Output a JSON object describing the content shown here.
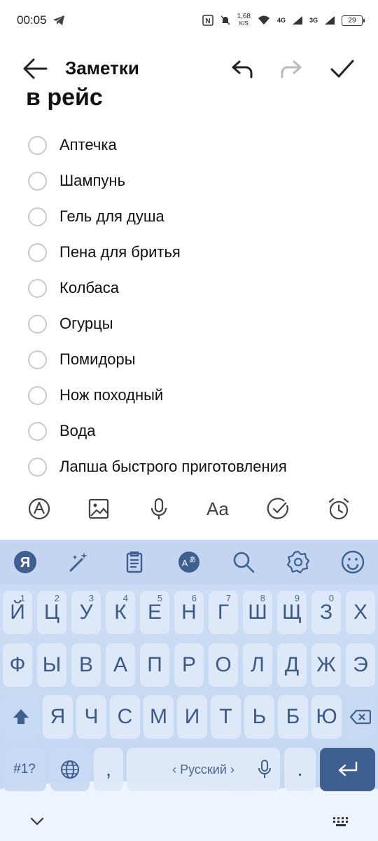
{
  "status": {
    "time": "00:05",
    "speed_value": "1,68",
    "speed_unit": "K/S",
    "net1": "4G",
    "net2": "3G",
    "battery": "29"
  },
  "header": {
    "title": "Заметки"
  },
  "note": {
    "title": "в рейс",
    "items": [
      "Аптечка",
      "Шампунь",
      "Гель для душа",
      "Пена для бритья",
      "Колбаса",
      "Огурцы",
      "Помидоры",
      "Нож походный",
      "Вода",
      "Лапша быстрого приготовления"
    ]
  },
  "keyboard": {
    "row1": [
      "Й",
      "Ц",
      "У",
      "К",
      "Е",
      "Н",
      "Г",
      "Ш",
      "Щ",
      "З",
      "Х"
    ],
    "row1_hints": [
      "1",
      "2",
      "3",
      "4",
      "5",
      "6",
      "7",
      "8",
      "9",
      "0",
      ""
    ],
    "row2": [
      "Ф",
      "Ы",
      "В",
      "А",
      "П",
      "Р",
      "О",
      "Л",
      "Д",
      "Ж",
      "Э"
    ],
    "row3": [
      "Я",
      "Ч",
      "С",
      "М",
      "И",
      "Т",
      "Ь",
      "Б",
      "Ю"
    ],
    "symbols_label": "#1?",
    "comma_label": ",",
    "space_label": "‹ Русский ›",
    "period_label": ".",
    "yandex_logo": "Я"
  },
  "icons": {
    "back": "arrow-left-icon",
    "undo": "undo-icon",
    "redo": "redo-icon",
    "done": "checkmark-icon",
    "accent_color": "#3e5f8f"
  }
}
